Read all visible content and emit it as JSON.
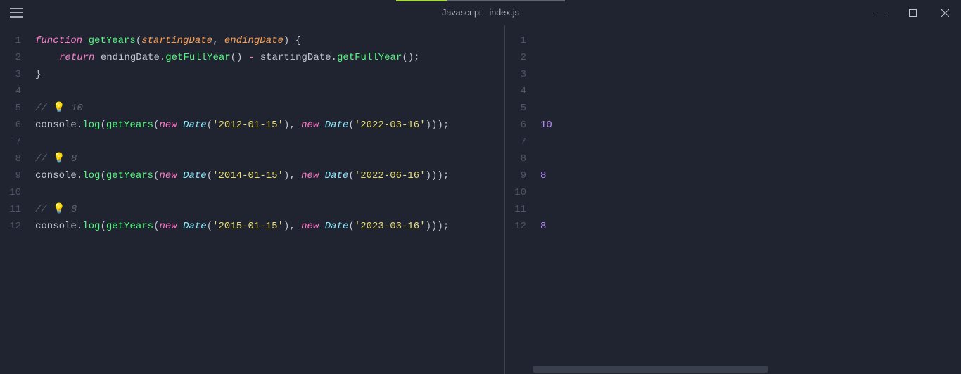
{
  "window": {
    "title": "Javascript - index.js"
  },
  "editor": {
    "line_count": 12,
    "code": {
      "l1": {
        "kw": "function",
        "fn": "getYears",
        "p1": "startingDate",
        "p2": "endingDate",
        "brace": "{"
      },
      "l2": {
        "kw": "return",
        "a": "endingDate",
        "m1": "getFullYear",
        "op": "-",
        "b": "startingDate",
        "m2": "getFullYear"
      },
      "l3": {
        "brace": "}"
      },
      "l5": {
        "cmt_prefix": "// ",
        "bulb": "💡",
        "cmt_val": " 10"
      },
      "l6": {
        "obj": "console",
        "method": "log",
        "fn": "getYears",
        "kw1": "new",
        "type1": "Date",
        "s1": "'2012-01-15'",
        "kw2": "new",
        "type2": "Date",
        "s2": "'2022-03-16'"
      },
      "l8": {
        "cmt_prefix": "// ",
        "bulb": "💡",
        "cmt_val": " 8"
      },
      "l9": {
        "obj": "console",
        "method": "log",
        "fn": "getYears",
        "kw1": "new",
        "type1": "Date",
        "s1": "'2014-01-15'",
        "kw2": "new",
        "type2": "Date",
        "s2": "'2022-06-16'"
      },
      "l11": {
        "cmt_prefix": "// ",
        "bulb": "💡",
        "cmt_val": " 8"
      },
      "l12": {
        "obj": "console",
        "method": "log",
        "fn": "getYears",
        "kw1": "new",
        "type1": "Date",
        "s1": "'2015-01-15'",
        "kw2": "new",
        "type2": "Date",
        "s2": "'2023-03-16'"
      }
    }
  },
  "output": {
    "line_count": 12,
    "values": {
      "6": "10",
      "9": "8",
      "12": "8"
    }
  },
  "gutter_numbers": [
    "1",
    "2",
    "3",
    "4",
    "5",
    "6",
    "7",
    "8",
    "9",
    "10",
    "11",
    "12"
  ]
}
